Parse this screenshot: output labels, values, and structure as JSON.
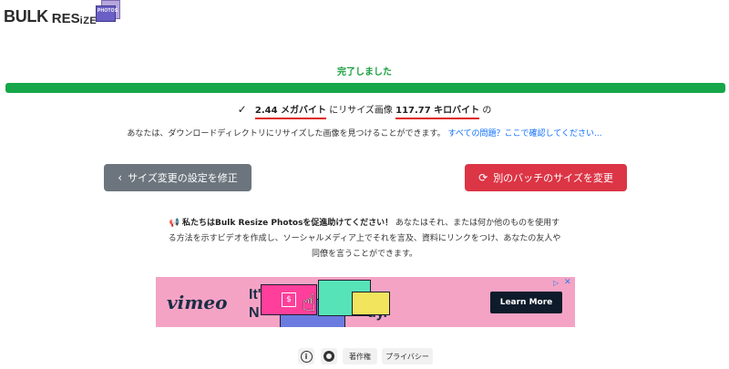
{
  "brand": {
    "name_bulk": "BULK",
    "name_re": "RES",
    "name_size": "iZE",
    "badge_text": "PHOTOS"
  },
  "status": {
    "text": "完了しました",
    "progress_percent": 100,
    "progress_color": "#17a64a"
  },
  "result": {
    "original_size": "2.44 メガバイト",
    "middle_text": "にリサイズ画像",
    "new_size": "117.77 キロバイト",
    "suffix": "の"
  },
  "hint": {
    "text": "あなたは、ダウンロードディレクトリにリサイズした画像を見つけることができます。",
    "link": "すべての問題？ここで確認してください..."
  },
  "buttons": {
    "back": "サイズ変更の設定を修正",
    "new_batch": "別のバッチのサイズを変更"
  },
  "promo": {
    "bold": "私たちはBulk Resize Photosを促進助けてください！",
    "text": "あなたはそれ、または何か他のものを使用する方法を示すビデオを作成し、ソーシャルメディア上でそれを言及、資料にリンクをつけ、あなたの友人や同僚を言うことができます。"
  },
  "ad": {
    "logo": "vimeo",
    "headline_1": "It'",
    "headline_1_end": "uy.",
    "headline_2": "N",
    "cta": "Learn More",
    "bg_color": "#f4a3c5"
  },
  "footer": {
    "copyright": "著作権",
    "privacy": "プライバシー"
  },
  "colors": {
    "success": "#17a64a",
    "danger": "#dc3545",
    "secondary": "#6c757d",
    "link": "#0d6efd"
  }
}
